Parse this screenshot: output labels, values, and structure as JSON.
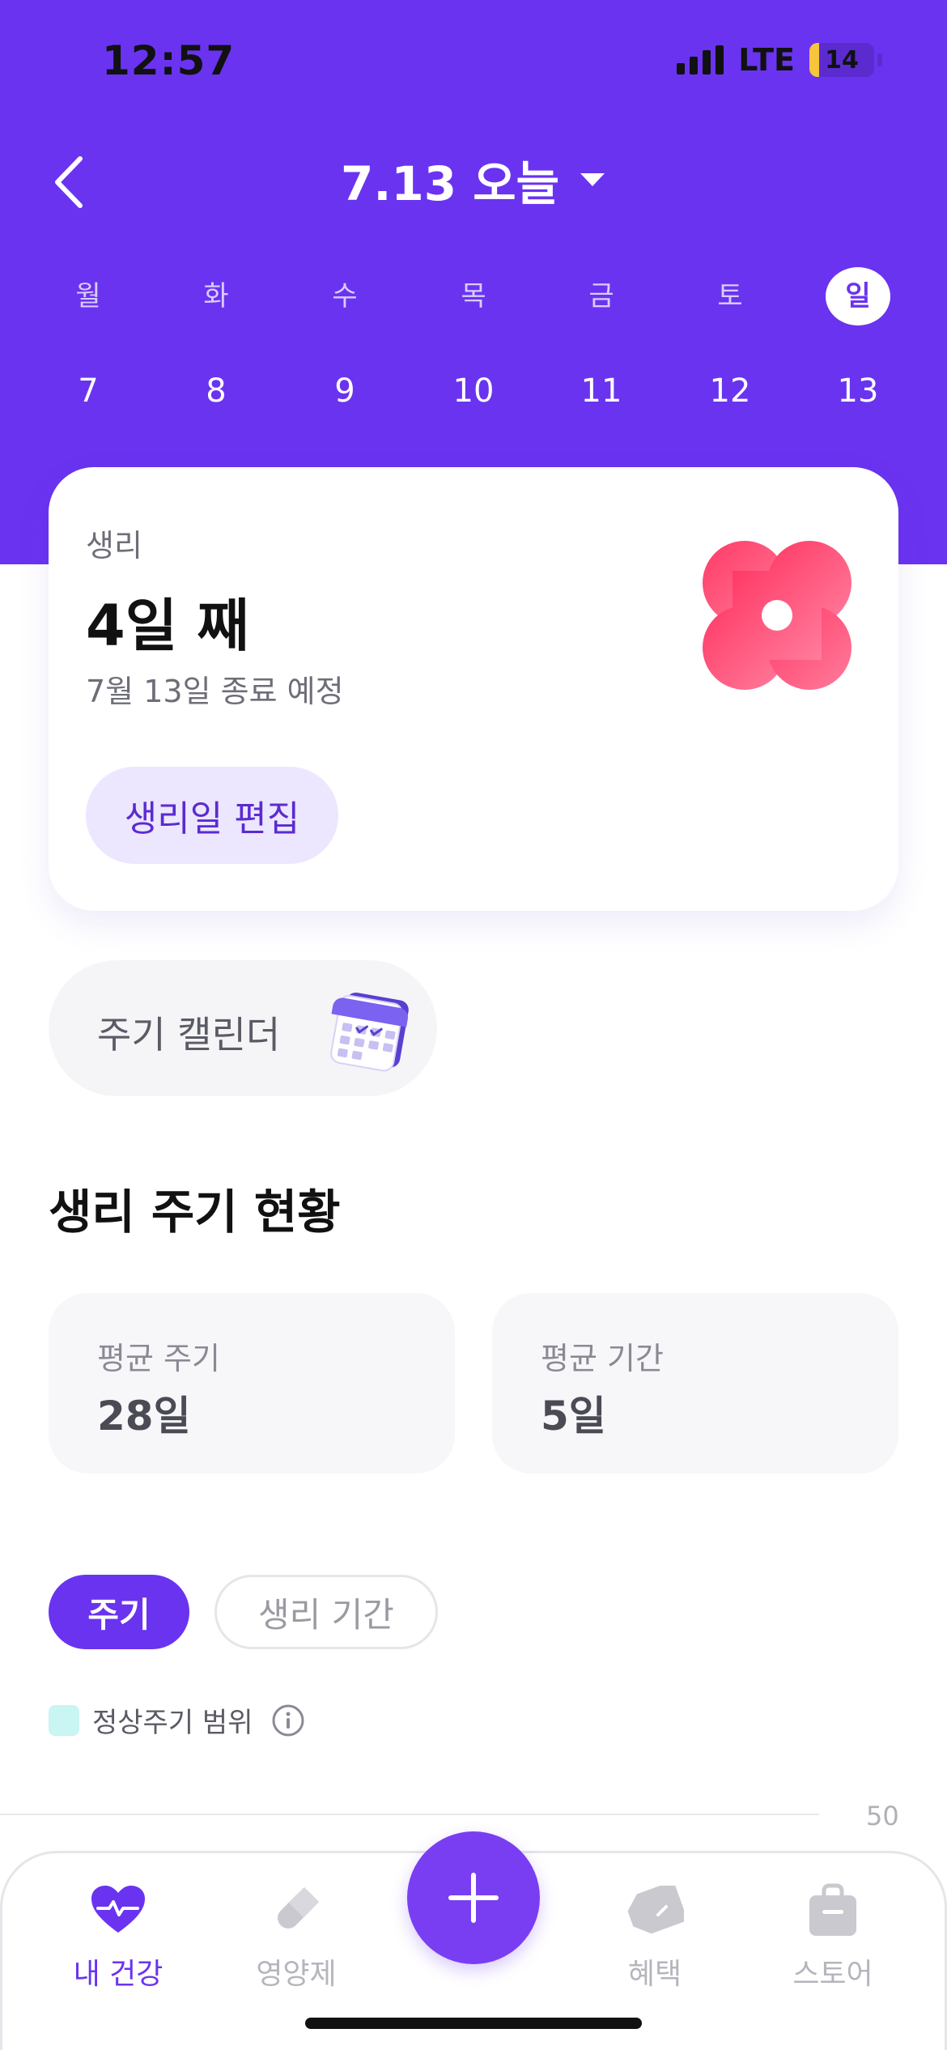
{
  "status_bar": {
    "time": "12:57",
    "network": "LTE",
    "battery": "14"
  },
  "header": {
    "title": "7.13 오늘",
    "colors": {
      "brand": "#6a33f0",
      "active_day_bg": "#ffffff"
    },
    "weekdays": [
      "월",
      "화",
      "수",
      "목",
      "금",
      "토",
      "일"
    ],
    "days": [
      "7",
      "8",
      "9",
      "10",
      "11",
      "12",
      "13"
    ],
    "selected_day_index": 6
  },
  "period_card": {
    "label": "생리",
    "day_count": "4일 째",
    "end_date": "7월 13일 종료 예정",
    "edit_button": "생리일 편집",
    "flower_color": "#ff4d72"
  },
  "calendar_button": {
    "label": "주기 캘린더"
  },
  "cycle_status": {
    "title": "생리 주기 현황",
    "stats": [
      {
        "label": "평균 주기",
        "value": "28일"
      },
      {
        "label": "평균 기간",
        "value": "5일"
      }
    ]
  },
  "chart_controls": {
    "chips": [
      "주기",
      "생리 기간"
    ],
    "active_chip": 0,
    "legend_label": "정상주기 범위",
    "legend_color": "#c9f5f2"
  },
  "chart_data": {
    "type": "bar",
    "ytick_labels": [
      "50"
    ]
  },
  "tab_bar": {
    "tabs": [
      {
        "label": "내 건강",
        "icon": "heart-pulse-icon",
        "active": true
      },
      {
        "label": "영양제",
        "icon": "pill-icon",
        "active": false
      },
      {
        "label": "혜택",
        "icon": "tag-icon",
        "active": false
      },
      {
        "label": "스토어",
        "icon": "shopping-bag-icon",
        "active": false
      }
    ],
    "fab_icon": "plus-icon"
  }
}
